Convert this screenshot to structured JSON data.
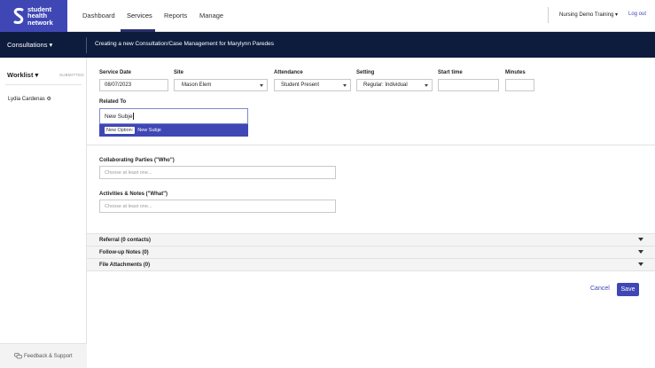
{
  "brand": {
    "logo_text_1": "student",
    "logo_text_2": "health",
    "logo_text_3": "network",
    "color": "#3f47b5"
  },
  "nav": {
    "dashboard": "Dashboard",
    "services": "Services",
    "reports": "Reports",
    "manage": "Manage",
    "active": "Services"
  },
  "account": {
    "org": "Nursing Demo Training ▾",
    "logout": "Log out"
  },
  "subheader": {
    "section": "Consultations ▾",
    "title": "Creating a new Consultation/Case Management for Marylynn Paredes"
  },
  "sidebar": {
    "worklist": "Worklist ▾",
    "status_tab": "SUBMITTED",
    "students": [
      "Lydia Cardenas ⚙"
    ],
    "feedback": "Feedback & Support"
  },
  "form": {
    "service_date": {
      "label": "Service Date",
      "value": "08/07/2023"
    },
    "site": {
      "label": "Site",
      "value": "Mason Elem"
    },
    "attendance": {
      "label": "Attendance",
      "value": "Student Present"
    },
    "setting": {
      "label": "Setting",
      "value": "Regular: Individual"
    },
    "start_time": {
      "label": "Start time",
      "value": ""
    },
    "minutes": {
      "label": "Minutes",
      "value": ""
    },
    "related_to": {
      "label": "Related To",
      "value": "New Subje",
      "option_badge": "New Option:",
      "option_text": "New Subje"
    },
    "collaborating": {
      "label": "Collaborating Parties (\"Who\")",
      "placeholder": "Choose at least one..."
    },
    "activities": {
      "label": "Activities & Notes (\"What\")",
      "placeholder": "Choose at least one..."
    }
  },
  "sections": [
    {
      "label": "Referral (0 contacts)"
    },
    {
      "label": "Follow-up Notes (0)"
    },
    {
      "label": "File Attachments (0)"
    }
  ],
  "actions": {
    "cancel": "Cancel",
    "save": "Save"
  },
  "icons": {
    "logo": "student-health-network-logo",
    "feedback": "chat-bubbles-icon",
    "caret": "chevron-down-icon"
  }
}
